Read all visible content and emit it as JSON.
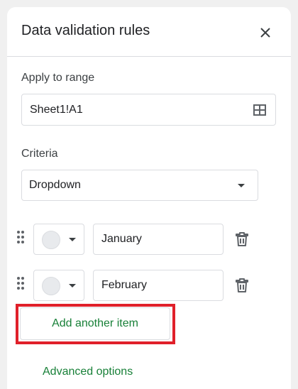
{
  "panel": {
    "title": "Data validation rules",
    "close_icon": "close-icon"
  },
  "range": {
    "label": "Apply to range",
    "value": "Sheet1!A1",
    "icon": "grid-select-icon"
  },
  "criteria": {
    "label": "Criteria",
    "selected": "Dropdown"
  },
  "items": [
    {
      "value": "January",
      "color": "#e8eaed"
    },
    {
      "value": "February",
      "color": "#e8eaed"
    }
  ],
  "actions": {
    "add_item_label": "Add another item",
    "advanced_label": "Advanced options"
  },
  "colors": {
    "accent_green": "#188038",
    "highlight_red": "#e0202a",
    "border": "#dadce0"
  }
}
